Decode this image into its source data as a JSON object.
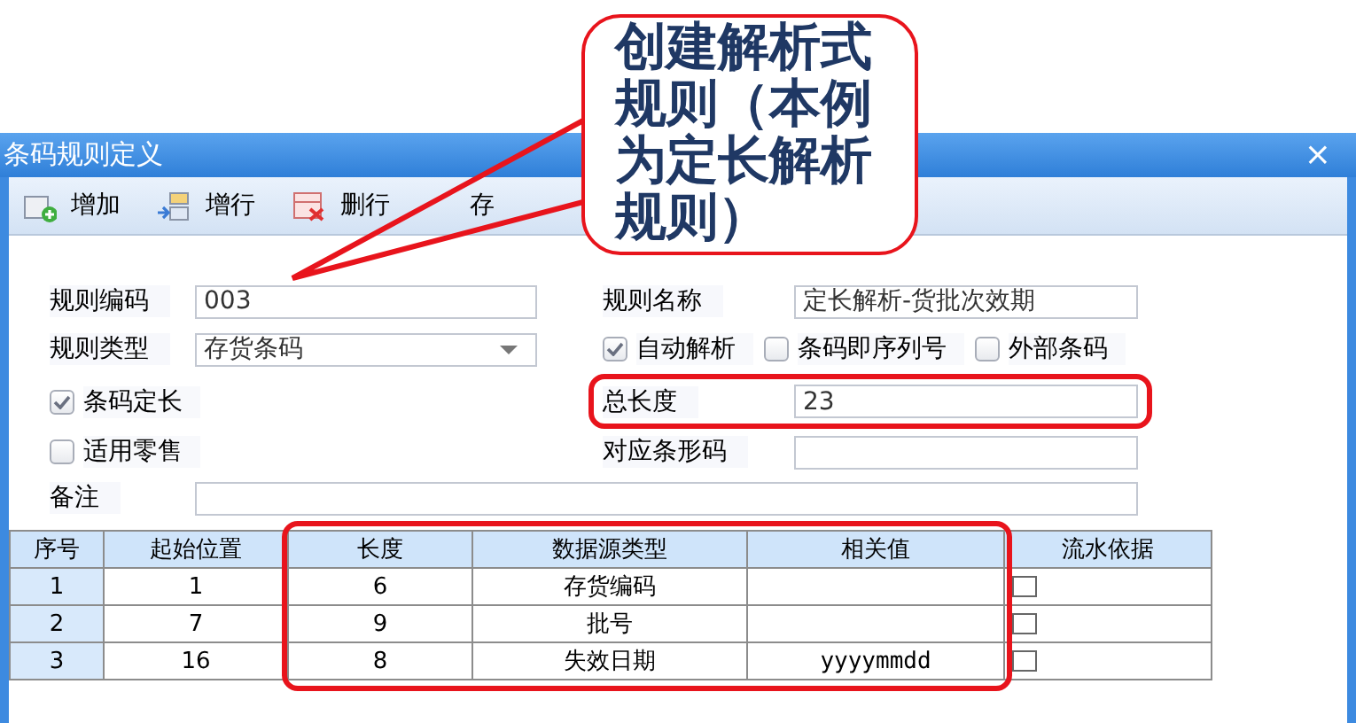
{
  "callout": {
    "text": "创建解析式规则（本例为定长解析规则）"
  },
  "window": {
    "title": "条码规则定义",
    "close": "×"
  },
  "toolbar": [
    {
      "label": "增加",
      "kind": "add"
    },
    {
      "label": "增行",
      "kind": "insert"
    },
    {
      "label": "删行",
      "kind": "delete"
    },
    {
      "label": "存",
      "kind": "save"
    }
  ],
  "form": {
    "rule_code": {
      "label": "规则编码",
      "value": "003"
    },
    "rule_name": {
      "label": "规则名称",
      "value": "定长解析-货批次效期"
    },
    "rule_type": {
      "label": "规则类型",
      "value": "存货条码"
    },
    "options": [
      {
        "label": "自动解析",
        "checked": true
      },
      {
        "label": "条码即序列号",
        "checked": false
      },
      {
        "label": "外部条码",
        "checked": false
      }
    ],
    "fixed_length": {
      "label": "条码定长",
      "checked": true
    },
    "total_length": {
      "label": "总长度",
      "value": "23",
      "highlighted": true
    },
    "retail": {
      "label": "适用零售",
      "checked": false
    },
    "barcode": {
      "label": "对应条形码"
    },
    "remark": {
      "label": "备注"
    }
  },
  "table": {
    "columns": [
      {
        "label": "序号",
        "highlighted": false
      },
      {
        "label": "起始位置",
        "highlighted": false
      },
      {
        "label": "长度",
        "highlighted": true
      },
      {
        "label": "数据源类型",
        "highlighted": true
      },
      {
        "label": "相关值",
        "highlighted": true
      },
      {
        "label": "流水依据",
        "highlighted": false
      }
    ],
    "rows": [
      {
        "cells": [
          "1",
          "1",
          "6",
          "存货编码",
          ""
        ],
        "serial": false
      },
      {
        "cells": [
          "2",
          "7",
          "9",
          "批号",
          ""
        ],
        "serial": false
      },
      {
        "cells": [
          "3",
          "16",
          "8",
          "失效日期",
          "yyyymmdd"
        ],
        "serial": false
      }
    ]
  }
}
